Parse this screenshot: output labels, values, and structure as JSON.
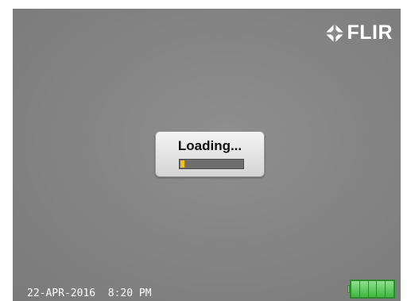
{
  "brand": {
    "logo_text": "FLIR",
    "logo_icon": "flir-diamond-icon"
  },
  "dialog": {
    "title": "Loading...",
    "progress_fraction": 0.06,
    "progress_color": "#f5c400"
  },
  "status_bar": {
    "date_time": "22-APR-2016  8:20 PM",
    "battery_icon": "battery-full-icon",
    "battery_level": 1.0,
    "battery_cells": 5,
    "battery_color": "#3fb83f"
  }
}
